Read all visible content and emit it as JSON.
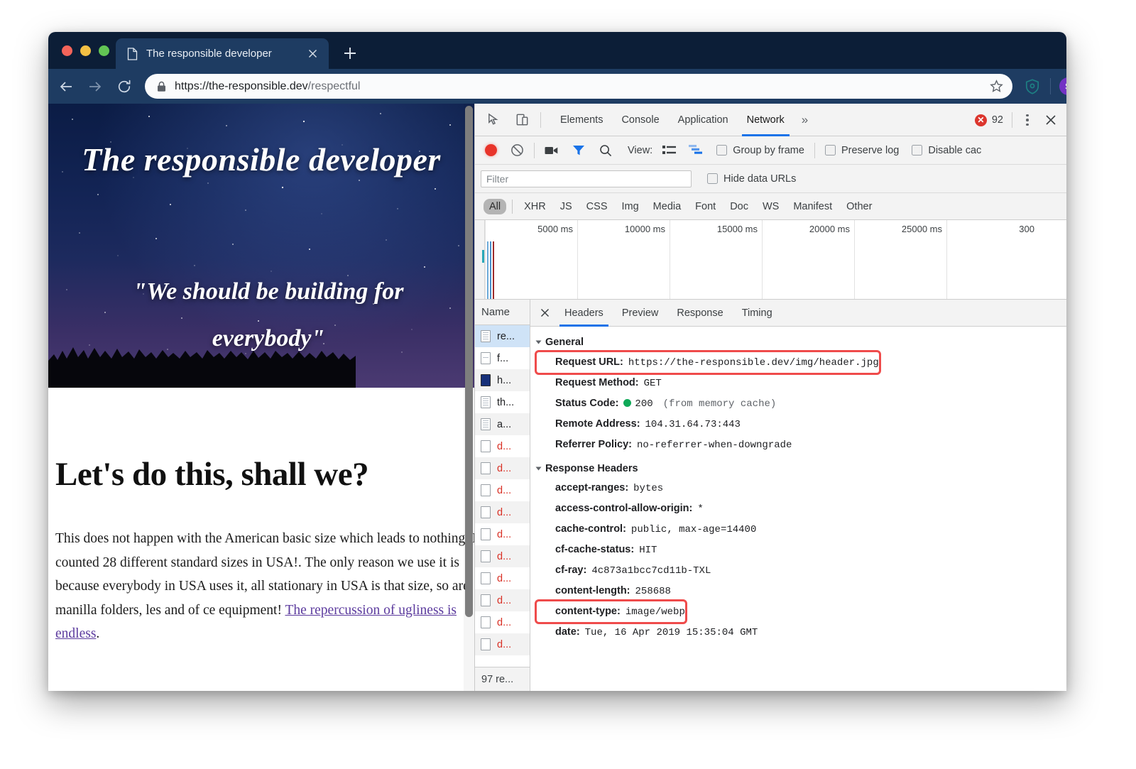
{
  "browser": {
    "tab_title": "The responsible developer",
    "url_scheme_host": "https://the-responsible.dev",
    "url_path": "/respectful",
    "profile_initial": "S"
  },
  "page": {
    "hero_title": "The responsible developer",
    "hero_quote": "\"We should be building for everybody\"",
    "heading": "Let's do this, shall we?",
    "paragraph_before": "This does not happen with the American basic size which leads to nothing. I counted 28 different standard sizes in USA!. The only reason we use it is because everybody in USA uses it, all stationary in USA is that size, so are manilla folders, les and of ce equipment! ",
    "paragraph_link": "The repercussion of ugliness is endless",
    "paragraph_after": "."
  },
  "devtools": {
    "tabs": [
      {
        "label": "Elements",
        "active": false
      },
      {
        "label": "Console",
        "active": false
      },
      {
        "label": "Application",
        "active": false
      },
      {
        "label": "Network",
        "active": true
      }
    ],
    "more_label": "»",
    "error_count": "92",
    "error_glyph": "✕",
    "network_toolbar": {
      "view_label": "View:",
      "group_by_frame": "Group by frame",
      "preserve_log": "Preserve log",
      "disable_cache": "Disable cac"
    },
    "filter": {
      "placeholder": "Filter",
      "value": "",
      "hide_data_urls": "Hide data URLs"
    },
    "type_filters": [
      {
        "label": "All",
        "active": true
      },
      {
        "label": "XHR",
        "active": false
      },
      {
        "label": "JS",
        "active": false
      },
      {
        "label": "CSS",
        "active": false
      },
      {
        "label": "Img",
        "active": false
      },
      {
        "label": "Media",
        "active": false
      },
      {
        "label": "Font",
        "active": false
      },
      {
        "label": "Doc",
        "active": false
      },
      {
        "label": "WS",
        "active": false
      },
      {
        "label": "Manifest",
        "active": false
      },
      {
        "label": "Other",
        "active": false
      }
    ],
    "timeline": {
      "ticks": [
        "5000 ms",
        "10000 ms",
        "15000 ms",
        "20000 ms",
        "25000 ms",
        "300"
      ]
    },
    "requests": {
      "column_header": "Name",
      "status_summary": "97 re...",
      "rows": [
        {
          "name": "re...",
          "icon": "doc",
          "state": "selected"
        },
        {
          "name": "f...",
          "icon": "css",
          "state": "normal"
        },
        {
          "name": "h...",
          "icon": "img-sel",
          "state": "active"
        },
        {
          "name": "th...",
          "icon": "doc",
          "state": "normal"
        },
        {
          "name": "a...",
          "icon": "doc",
          "state": "odd"
        },
        {
          "name": "d...",
          "icon": "blank",
          "state": "error"
        },
        {
          "name": "d...",
          "icon": "blank",
          "state": "error-odd"
        },
        {
          "name": "d...",
          "icon": "blank",
          "state": "error"
        },
        {
          "name": "d...",
          "icon": "blank",
          "state": "error-odd"
        },
        {
          "name": "d...",
          "icon": "blank",
          "state": "error"
        },
        {
          "name": "d...",
          "icon": "blank",
          "state": "error-odd"
        },
        {
          "name": "d...",
          "icon": "blank",
          "state": "error"
        },
        {
          "name": "d...",
          "icon": "blank",
          "state": "error-odd"
        },
        {
          "name": "d...",
          "icon": "blank",
          "state": "error"
        },
        {
          "name": "d...",
          "icon": "blank",
          "state": "error-odd"
        }
      ]
    },
    "details": {
      "tabs": [
        {
          "label": "Headers",
          "active": true
        },
        {
          "label": "Preview",
          "active": false
        },
        {
          "label": "Response",
          "active": false
        },
        {
          "label": "Timing",
          "active": false
        }
      ],
      "general_title": "General",
      "general": [
        {
          "key": "Request URL:",
          "value": "https://the-responsible.dev/img/header.jpg",
          "highlight": true
        },
        {
          "key": "Request Method:",
          "value": "GET",
          "highlight": false
        },
        {
          "key": "Status Code:",
          "value": "200",
          "extra": "(from memory cache)",
          "dot": true,
          "highlight": false
        },
        {
          "key": "Remote Address:",
          "value": "104.31.64.73:443",
          "highlight": false
        },
        {
          "key": "Referrer Policy:",
          "value": "no-referrer-when-downgrade",
          "highlight": false
        }
      ],
      "response_title": "Response Headers",
      "response": [
        {
          "key": "accept-ranges:",
          "value": "bytes",
          "highlight": false
        },
        {
          "key": "access-control-allow-origin:",
          "value": "*",
          "highlight": false
        },
        {
          "key": "cache-control:",
          "value": "public, max-age=14400",
          "highlight": false
        },
        {
          "key": "cf-cache-status:",
          "value": "HIT",
          "highlight": false
        },
        {
          "key": "cf-ray:",
          "value": "4c873a1bcc7cd11b-TXL",
          "highlight": false
        },
        {
          "key": "content-length:",
          "value": "258688",
          "highlight": false
        },
        {
          "key": "content-type:",
          "value": "image/webp",
          "highlight": true
        },
        {
          "key": "date:",
          "value": "Tue, 16 Apr 2019 15:35:04 GMT",
          "highlight": false
        }
      ]
    }
  },
  "colors": {
    "accent_blue": "#1a73e8",
    "error_red": "#d93025",
    "highlight_box": "#ef4b4b",
    "status_green": "#0fa958",
    "titlebar": "#0c1e37",
    "toolbar": "#1e3c62"
  }
}
